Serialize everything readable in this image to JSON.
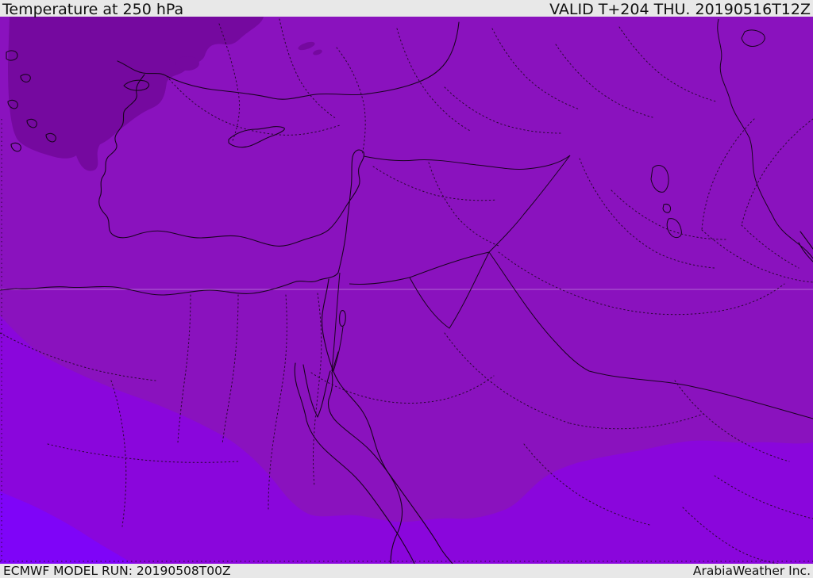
{
  "header": {
    "title": "Temperature at 250 hPa",
    "valid": "VALID T+204 THU. 20190516T12Z"
  },
  "footer": {
    "model_run": "ECMWF MODEL RUN: 20190508T00Z",
    "attribution": "ArabiaWeather Inc."
  },
  "colors": {
    "bar_bg": "#e8e8e8",
    "bar_text": "#111111",
    "band_medium": "#8A12BE",
    "band_dark": "#75099F",
    "band_bright": "#8A06DC",
    "band_brightest": "#7F04F8",
    "line_color": "#19031f",
    "dotted_color": "#2a0734",
    "faint_line": "rgba(255,255,255,0.35)"
  }
}
